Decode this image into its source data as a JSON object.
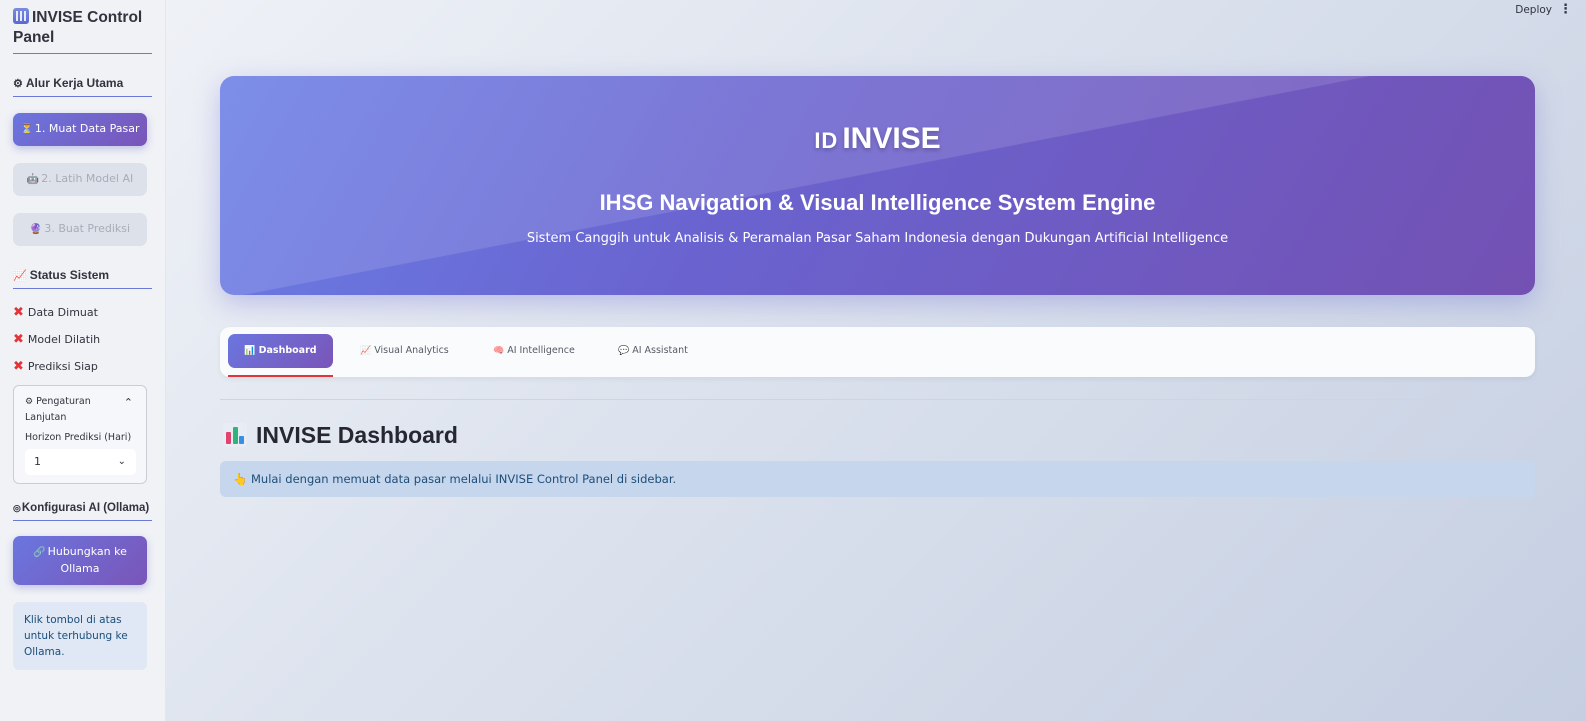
{
  "sidebar": {
    "title": "INVISE Control Panel",
    "workflow_heading": "Alur Kerja Utama",
    "workflow_buttons": [
      {
        "icon": "loading-icon",
        "label": "1. Muat Data Pasar"
      },
      {
        "icon": "robot-icon",
        "label": "2. Latih Model AI"
      },
      {
        "icon": "crystal-ball-icon",
        "label": "3. Buat Prediksi"
      }
    ],
    "status_heading": "Status Sistem",
    "status_items": [
      {
        "label": "Data Dimuat",
        "state": "✖"
      },
      {
        "label": "Model Dilatih",
        "state": "✖"
      },
      {
        "label": "Prediksi Siap",
        "state": "✖"
      }
    ],
    "advanced": {
      "label": "Pengaturan Lanjutan",
      "horizon_label": "Horizon Prediksi (Hari)",
      "horizon_value": "1"
    },
    "ai_heading": "Konfigurasi AI (Ollama)",
    "connect_button": "Hubungkan ke Ollama",
    "info_text": "Klik tombol di atas untuk terhubung ke Ollama."
  },
  "topbar": {
    "deploy_label": "Deploy",
    "menu_glyph": "⋮"
  },
  "hero": {
    "flag_text": "ID",
    "title": "INVISE",
    "subtitle": "IHSG Navigation & Visual Intelligence System Engine",
    "description": "Sistem Canggih untuk Analisis & Peramalan Pasar Saham Indonesia dengan Dukungan Artificial Intelligence"
  },
  "tabs": [
    {
      "label": "Dashboard",
      "icon": "bar-chart-icon",
      "active": true
    },
    {
      "label": "Visual Analytics",
      "icon": "trend-chart-icon",
      "active": false
    },
    {
      "label": "AI Intelligence",
      "icon": "brain-icon",
      "active": false
    },
    {
      "label": "AI Assistant",
      "icon": "speech-bubble-icon",
      "active": false
    }
  ],
  "main": {
    "title": "INVISE Dashboard",
    "alert_text": "Mulai dengan memuat data pasar melalui INVISE Control Panel di sidebar."
  },
  "colors": {
    "accent_start": "#6a76df",
    "accent_end": "#7a55b8",
    "error": "#e2353b",
    "info_text": "#1d4e79"
  }
}
